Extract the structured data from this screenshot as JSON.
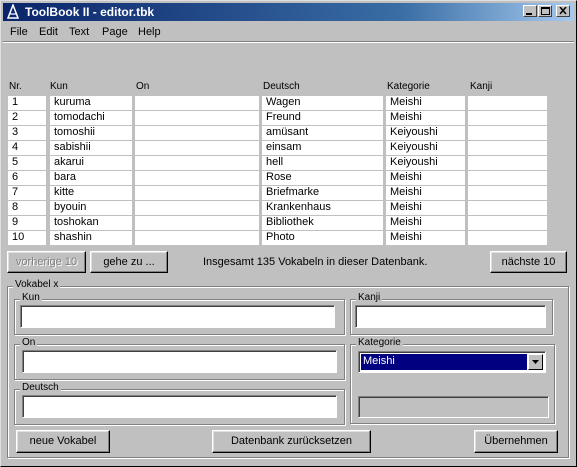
{
  "window": {
    "title": "ToolBook II - editor.tbk"
  },
  "menu": [
    "File",
    "Edit",
    "Text",
    "Page",
    "Help"
  ],
  "table": {
    "headers": [
      "Nr.",
      "Kun",
      "On",
      "Deutsch",
      "Kategorie",
      "Kanji"
    ],
    "rows": [
      {
        "nr": "1",
        "kun": "kuruma",
        "on": "",
        "deutsch": "Wagen",
        "kategorie": "Meishi",
        "kanji": ""
      },
      {
        "nr": "2",
        "kun": "tomodachi",
        "on": "",
        "deutsch": "Freund",
        "kategorie": "Meishi",
        "kanji": ""
      },
      {
        "nr": "3",
        "kun": "tomoshii",
        "on": "",
        "deutsch": "amüsant",
        "kategorie": "Keiyoushi",
        "kanji": ""
      },
      {
        "nr": "4",
        "kun": "sabishii",
        "on": "",
        "deutsch": "einsam",
        "kategorie": "Keiyoushi",
        "kanji": ""
      },
      {
        "nr": "5",
        "kun": "akarui",
        "on": "",
        "deutsch": "hell",
        "kategorie": "Keiyoushi",
        "kanji": ""
      },
      {
        "nr": "6",
        "kun": "bara",
        "on": "",
        "deutsch": "Rose",
        "kategorie": "Meishi",
        "kanji": ""
      },
      {
        "nr": "7",
        "kun": "kitte",
        "on": "",
        "deutsch": "Briefmarke",
        "kategorie": "Meishi",
        "kanji": ""
      },
      {
        "nr": "8",
        "kun": "byouin",
        "on": "",
        "deutsch": "Krankenhaus",
        "kategorie": "Meishi",
        "kanji": ""
      },
      {
        "nr": "9",
        "kun": "toshokan",
        "on": "",
        "deutsch": "Bibliothek",
        "kategorie": "Meishi",
        "kanji": ""
      },
      {
        "nr": "10",
        "kun": "shashin",
        "on": "",
        "deutsch": "Photo",
        "kategorie": "Meishi",
        "kanji": ""
      }
    ]
  },
  "nav": {
    "prev_label": "vorherige 10",
    "goto_label": "gehe zu ...",
    "status": "Insgesamt 135 Vokabeln in dieser Datenbank.",
    "next_label": "nächste 10"
  },
  "form": {
    "group_label": "Vokabel x",
    "kun_label": "Kun",
    "kun_value": "",
    "kanji_label": "Kanji",
    "kanji_value": "",
    "on_label": "On",
    "on_value": "",
    "kategorie_label": "Kategorie",
    "kategorie_value": "Meishi",
    "deutsch_label": "Deutsch",
    "deutsch_value": "",
    "new_button": "neue Vokabel",
    "reset_button": "Datenbank zurücksetzen",
    "apply_button": "Übernehmen"
  }
}
